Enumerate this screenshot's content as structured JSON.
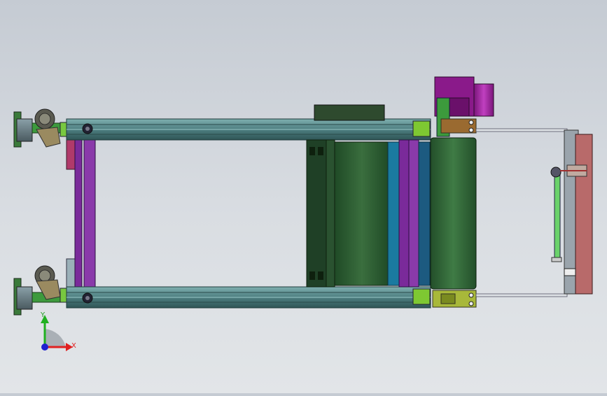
{
  "viewport": {
    "background_top": "#c5cbd3",
    "background_bottom": "#e2e5e8",
    "view_orientation": "top"
  },
  "triad": {
    "x_label": "X",
    "y_label": "Y",
    "x_color": "#e02020",
    "y_color": "#20b020",
    "z_color": "#2020d0"
  },
  "model": {
    "frame_color": "#4a7a7a",
    "belt_color": "#2f5e34",
    "motor_color": "#9a1a9a",
    "bracket_color": "#7ec832",
    "panel_color": "#b86a6a"
  }
}
